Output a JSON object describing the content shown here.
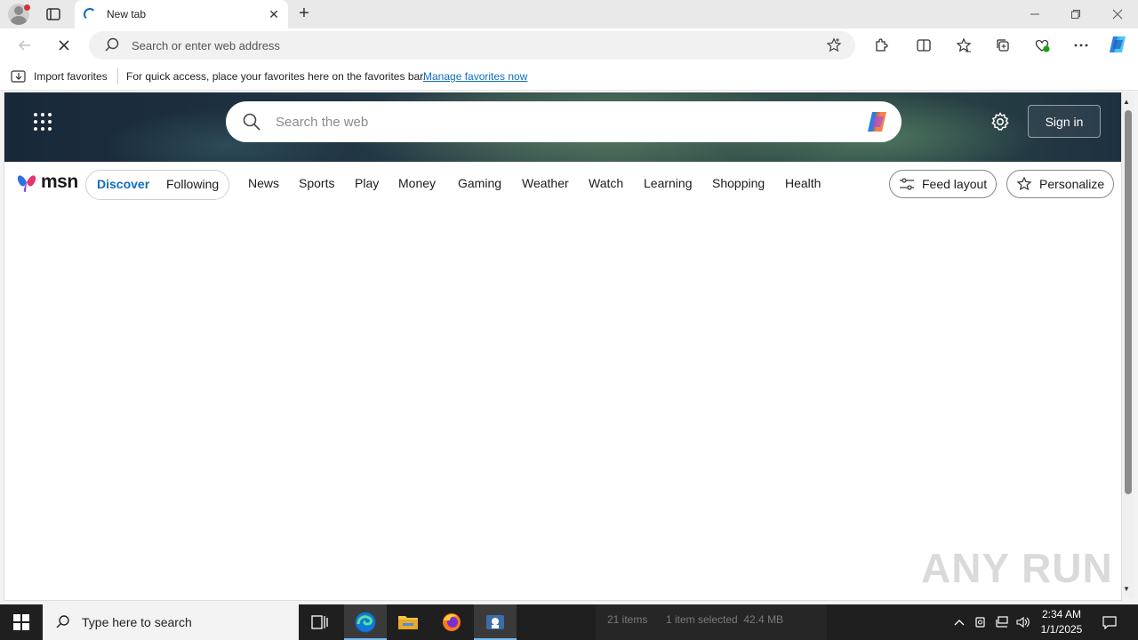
{
  "browser": {
    "tab": {
      "title": "New tab"
    },
    "address_bar": {
      "placeholder": "Search or enter web address",
      "value": ""
    },
    "favorites_bar": {
      "import_label": "Import favorites",
      "message": "For quick access, place your favorites here on the favorites bar.",
      "manage_link": "Manage favorites now"
    }
  },
  "msn": {
    "search": {
      "placeholder": "Search the web"
    },
    "signin_label": "Sign in",
    "logo_text": "msn",
    "pill_tabs": [
      {
        "label": "Discover",
        "active": true
      },
      {
        "label": "Following",
        "active": false
      }
    ],
    "categories": [
      "News",
      "Sports",
      "Play",
      "Money",
      "Gaming",
      "Weather",
      "Watch",
      "Learning",
      "Shopping",
      "Health"
    ],
    "feed_layout_label": "Feed layout",
    "personalize_label": "Personalize"
  },
  "watermark": "ANY RUN",
  "taskbar": {
    "search_placeholder": "Type here to search",
    "background_status": {
      "items": "21 items",
      "selected": "1 item selected  42.4 MB"
    },
    "clock": {
      "time": "2:34 AM",
      "date": "1/1/2025"
    }
  },
  "colors": {
    "accent": "#0f6cbd",
    "taskbar": "#1f1f1f"
  }
}
